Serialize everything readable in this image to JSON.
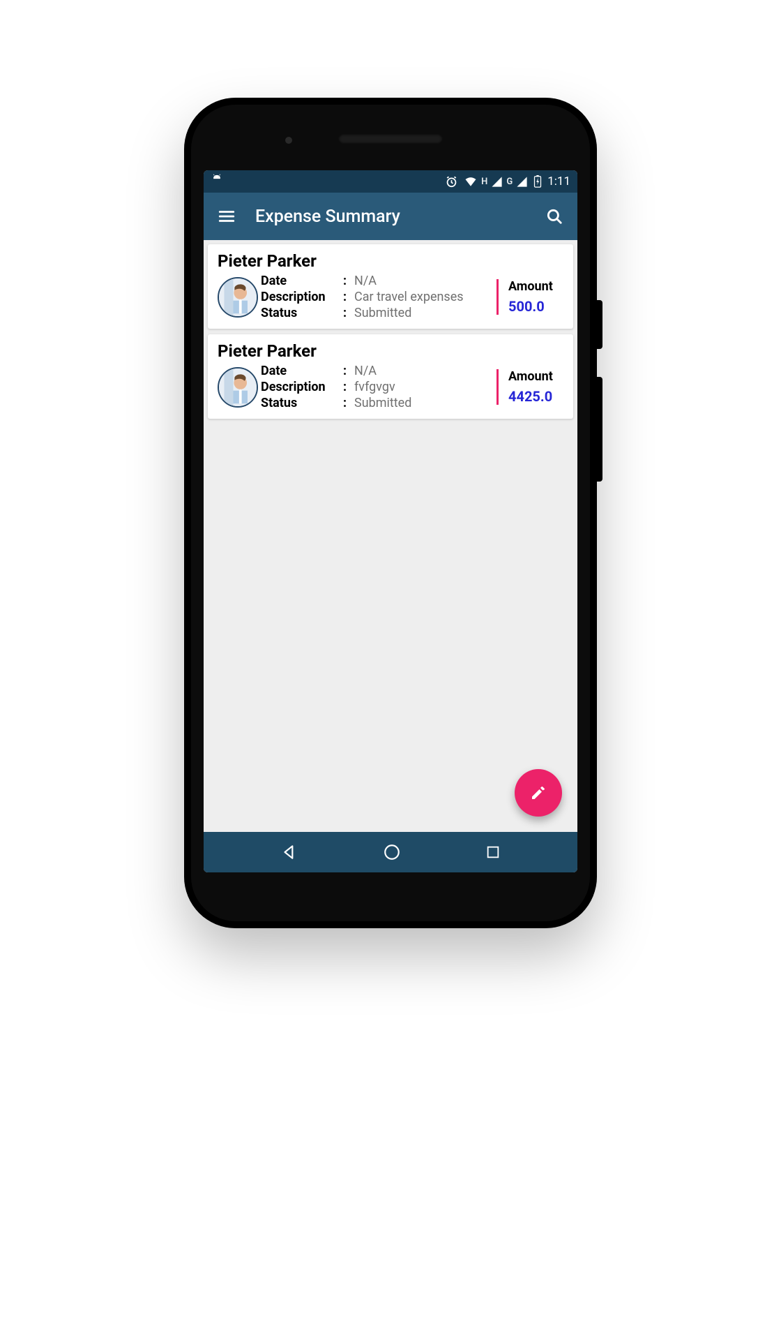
{
  "status": {
    "time": "1:11",
    "indicators": {
      "net1": "H",
      "net2": "G"
    }
  },
  "appbar": {
    "title": "Expense Summary"
  },
  "labels": {
    "date": "Date",
    "description": "Description",
    "status": "Status",
    "amount": "Amount",
    "colon": ":"
  },
  "expenses": [
    {
      "name": "Pieter Parker",
      "date": "N/A",
      "description": "Car travel expenses",
      "status": "Submitted",
      "amount": "500.0"
    },
    {
      "name": "Pieter Parker",
      "date": "N/A",
      "description": "fvfgvgv",
      "status": "Submitted",
      "amount": "4425.0"
    }
  ]
}
